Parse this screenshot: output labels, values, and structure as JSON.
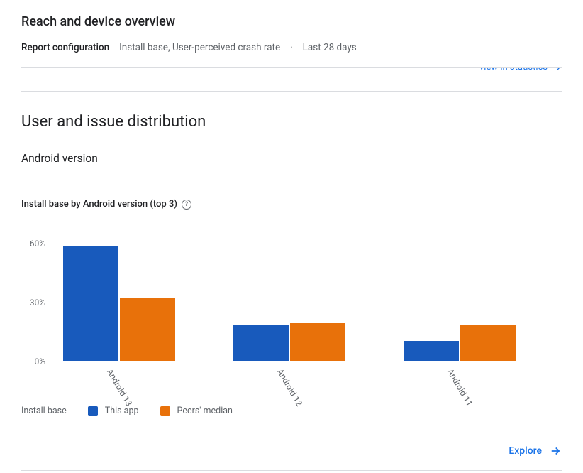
{
  "header": {
    "title": "Reach and device overview",
    "config_label": "Report configuration",
    "config_value": "Install base, User-perceived crash rate",
    "time_range": "Last 28 days",
    "top_link_partial": "view in statistics"
  },
  "section": {
    "title": "User and issue distribution",
    "subtitle": "Android version",
    "chart_title": "Install base by Android version (top 3)"
  },
  "legend": {
    "caption": "Install base",
    "series_a": "This app",
    "series_b": "Peers' median"
  },
  "explore": {
    "label": "Explore"
  },
  "chart_data": {
    "type": "bar",
    "categories": [
      "Android 13",
      "Android 12",
      "Android 11"
    ],
    "series": [
      {
        "name": "This app",
        "values": [
          58,
          18,
          10
        ]
      },
      {
        "name": "Peers' median",
        "values": [
          32,
          19,
          18
        ]
      }
    ],
    "title": "Install base by Android version (top 3)",
    "xlabel": "",
    "ylabel": "",
    "y_unit": "%",
    "ylim": [
      0,
      65
    ],
    "y_ticks": [
      0,
      30,
      60
    ],
    "colors": {
      "This app": "#185abc",
      "Peers' median": "#e8710a"
    }
  }
}
